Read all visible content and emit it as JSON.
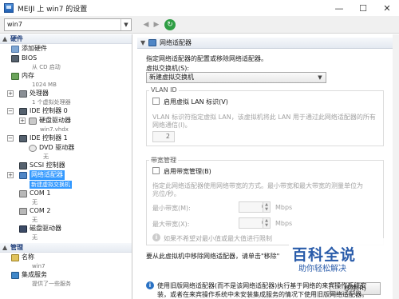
{
  "window": {
    "title": "MEIJI 上 win7 的设置",
    "minimize": "—",
    "maximize": "☐",
    "close": "✕"
  },
  "toolbar": {
    "vm_select": "win7",
    "back": "◀",
    "forward": "▶",
    "refresh": "↻"
  },
  "tree": {
    "hardware_header": "硬件",
    "add_hardware": "添加硬件",
    "bios": "BIOS",
    "bios_sub": "从 CD 启动",
    "memory": "内存",
    "memory_sub": "1024 MB",
    "processor": "处理器",
    "processor_sub": "1 个虚拟处理器",
    "ide0": "IDE 控制器 0",
    "hard_drive": "硬盘驱动器",
    "hard_drive_sub": "win7.vhdx",
    "ide1": "IDE 控制器 1",
    "dvd": "DVD 驱动器",
    "dvd_sub": "无",
    "scsi": "SCSI 控制器",
    "net_adapter": "网络适配器",
    "net_adapter_sub": "新建虚拟交换机",
    "com1": "COM 1",
    "com1_sub": "无",
    "com2": "COM 2",
    "com2_sub": "无",
    "floppy": "磁盘驱动器",
    "floppy_sub": "无",
    "management_header": "管理",
    "name": "名称",
    "name_sub": "win7",
    "integration": "集成服务",
    "integration_sub": "提供了一些服务"
  },
  "panel": {
    "header": "网络适配器",
    "description": "指定网络适配器的配置或移除网络适配器。",
    "switch_label": "虚拟交换机(S):",
    "switch_value": "新建虚拟交换机",
    "vlan_title": "VLAN ID",
    "vlan_checkbox": "启用虚拟 LAN 标识(V)",
    "vlan_desc1": "VLAN 标识符指定虚拟 LAN，该虚拟机将此 LAN 用于通过此网络适配器的所有",
    "vlan_desc2": "网络通信(I)。",
    "vlan_value": "2",
    "bw_title": "带宽管理",
    "bw_checkbox": "启用带宽管理(B)",
    "bw_desc1": "指定此网络适配器使用网络带宽的方式。最小带宽和最大带宽的测量单位为",
    "bw_desc2": "兆位/秒。",
    "min_bw_label": "最小带宽(M):",
    "min_bw_value": "0",
    "min_bw_unit": "Mbps",
    "max_bw_label": "最大带宽(X):",
    "max_bw_value": "0",
    "max_bw_unit": "Mbps",
    "bw_info": "如果不希望对最小值或最大值进行限制",
    "remove_desc": "要从此虚拟机中移除网络适配器，请单击\"移除\"",
    "remove_button": "移除(R)",
    "bottom_info1": "使用旧版网络适配器(而不是该网络适配器)执行基于网络的来宾操作系统安",
    "bottom_info2": "装，或者在来宾操作系统中未安装集成服务的情况下使用旧版网络适配器。"
  },
  "watermark": {
    "logo": "百科全说",
    "sub": "助你轻松解决"
  }
}
